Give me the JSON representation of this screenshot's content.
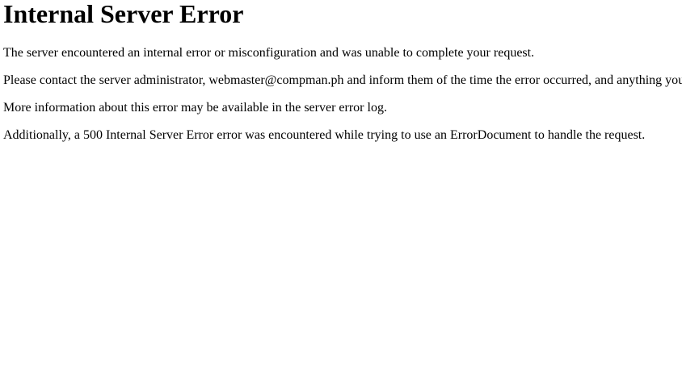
{
  "page": {
    "title": "Internal Server Error",
    "paragraphs": [
      "The server encountered an internal error or misconfiguration and was unable to complete your request.",
      "Please contact the server administrator, webmaster@compman.ph and inform them of the time the error occurred, and anything you might have done that may have caused the error.",
      "More information about this error may be available in the server error log.",
      "Additionally, a 500 Internal Server Error error was encountered while trying to use an ErrorDocument to handle the request."
    ]
  }
}
